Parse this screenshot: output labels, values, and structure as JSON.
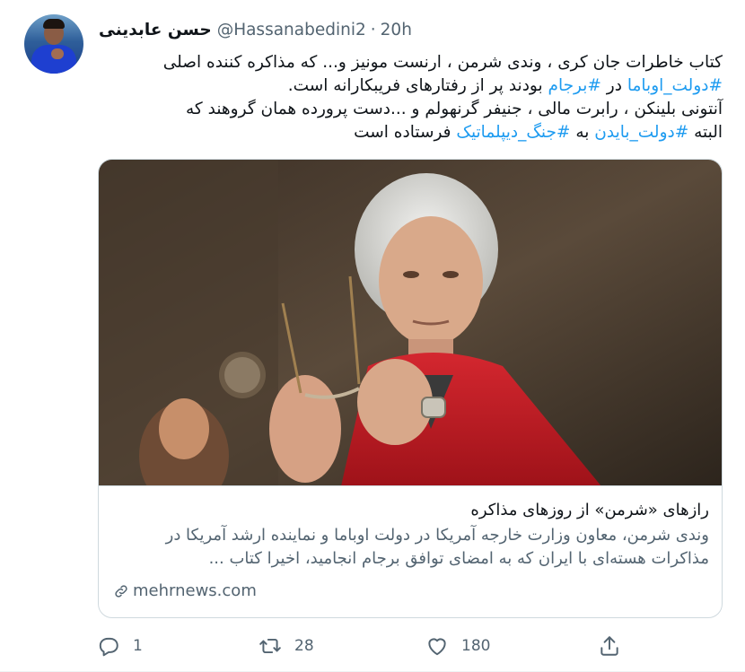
{
  "tweet": {
    "author_name": "حسن عابدینی",
    "handle": "@Hassanabedini2",
    "separator": "·",
    "time": "20h",
    "text_lines": [
      [
        {
          "t": "کتاب خاطرات جان کری ، وندی شرمن ، ارنست مونیز و... که مذاکره کننده اصلی",
          "h": false
        }
      ],
      [
        {
          "t": "#دولت_اوباما",
          "h": true
        },
        {
          "t": " در ",
          "h": false
        },
        {
          "t": "#برجام",
          "h": true
        },
        {
          "t": " بودند پر از رفتارهای  فریبکارانه است.",
          "h": false
        }
      ],
      [
        {
          "t": "آنتونی بلینکن ، رابرت مالی ، جنیفر گرنهولم و ...دست پرورده همان گروهند که",
          "h": false
        }
      ],
      [
        {
          "t": "البته ",
          "h": false
        },
        {
          "t": "#دولت_بایدن",
          "h": true
        },
        {
          "t": " به ",
          "h": false
        },
        {
          "t": "#جنگ_دیپلماتیک",
          "h": true
        },
        {
          "t": " فرستاده است",
          "h": false
        }
      ]
    ]
  },
  "card": {
    "title": "رازهای «شرمن» از روزهای مذاکره",
    "description_lines": [
      "وندی شرمن، معاون وزارت خارجه آمریکا در دولت اوباما و نماینده ارشد آمریکا در",
      "مذاکرات هسته‌ای با ایران که به امضای توافق برجام انجامید، اخیرا کتاب ..."
    ],
    "domain": "mehrnews.com",
    "link_icon": "link-icon"
  },
  "actions": {
    "reply": {
      "icon": "reply-icon",
      "count": "1"
    },
    "retweet": {
      "icon": "retweet-icon",
      "count": "28"
    },
    "like": {
      "icon": "heart-icon",
      "count": "180"
    },
    "share": {
      "icon": "share-icon",
      "count": ""
    }
  },
  "colors": {
    "hashtag": "#1d9bf0",
    "secondary_text": "#536471",
    "border": "#cfd9de"
  }
}
